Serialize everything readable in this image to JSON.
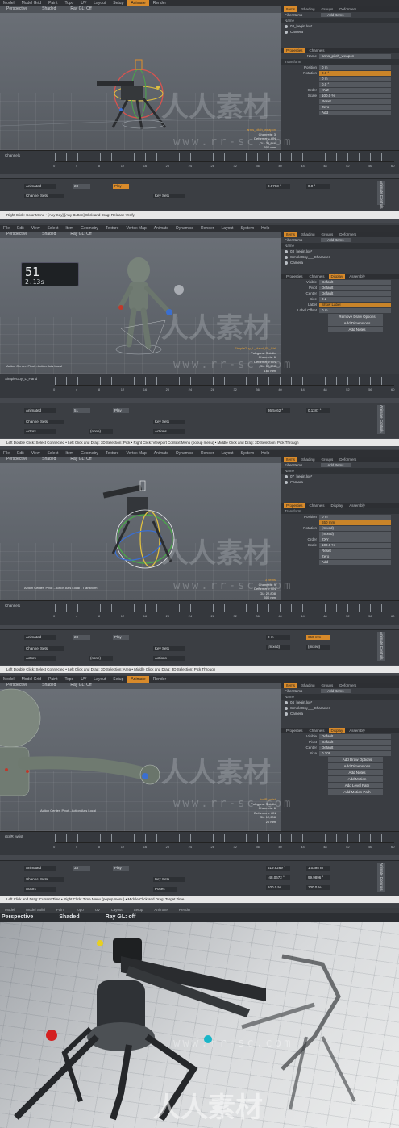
{
  "menus": {
    "tabs1": [
      "Model",
      "Model Grid",
      "Paint",
      "Topo",
      "UV",
      "Layout",
      "Setup",
      "Animate",
      "Render"
    ],
    "tabs2": [
      "File",
      "Edit",
      "View",
      "Select",
      "Item",
      "Geometry",
      "Texture",
      "Vertex Map",
      "Animate",
      "Dynamics",
      "Render",
      "Layout",
      "System",
      "Help"
    ]
  },
  "panels": [
    {
      "viewport": {
        "view": "Perspective",
        "shade": "Shaded",
        "ray": "Ray GL: Off"
      },
      "info": [
        "arms_pitch_weapon",
        "Channels: 3",
        "Deformers: ON",
        "GL: 23,846",
        "500 mm"
      ],
      "side_tabs": [
        "Items",
        "Shading",
        "Groups",
        "Deformers"
      ],
      "items": [
        "03_begin.lxo*",
        "Camera"
      ],
      "prop_tabs": [
        "Properties",
        "Channels"
      ],
      "name": "arms_pitch_weapon",
      "section": "Transform",
      "fields": [
        {
          "label": "Position",
          "value": "0 m"
        },
        {
          "label": "Rotation",
          "value": "0.0 °"
        },
        {
          "label": "",
          "value": "0 m"
        },
        {
          "label": "",
          "value": "0.0 °"
        },
        {
          "label": "Order",
          "value": "XYZ"
        },
        {
          "label": "Scale",
          "value": "100.0 %"
        }
      ],
      "reset_items": [
        "Reset",
        "Zero",
        "Add"
      ],
      "timeline_label": "Channels",
      "frame": "23",
      "values": [
        "0.0763 °",
        "0.0 °"
      ]
    },
    {
      "viewport": {
        "view": "Perspective",
        "shade": "Shaded",
        "ray": "Ray GL: Off"
      },
      "info": [
        "SimpleGuy_L_Hand_Fk_Ctrl",
        "Polygons: Subdiv",
        "Channels: 6",
        "Deformers: ON",
        "GL: 12,208",
        "160 mm"
      ],
      "timebox": {
        "frame": "51",
        "time": "2.13s"
      },
      "side_tabs": [
        "Items",
        "Shading",
        "Groups",
        "Deformers"
      ],
      "items": [
        "03_begin.lxo*",
        "SimpleGuy___Character",
        "Camera"
      ],
      "prop_tabs": [
        "Properties",
        "Channels",
        "Display",
        "Assembly"
      ],
      "fields": [
        {
          "label": "Visible",
          "value": "Default"
        },
        {
          "label": "Pivot",
          "value": "Default"
        },
        {
          "label": "Center",
          "value": "Default"
        },
        {
          "label": "Size",
          "value": "0.2"
        },
        {
          "label": "Label",
          "value": "Show Label"
        },
        {
          "label": "Label Offset",
          "value": "0 m"
        }
      ],
      "buttons": [
        "Remove Draw Options",
        "Add Dimensions",
        "Add Notes"
      ],
      "action_center": "Action Center: Pivot - Action Axis Local",
      "timeline_label": "SimpleGuy_L_Hand",
      "frame": "51",
      "values": [
        "36.5462 °",
        "0.1187 °"
      ],
      "status": "Left Double Click: Select Connected  •  Left Click and Drag: 3D Selection: Pick  •  Right Click: Viewport Context Menu (popup menu)  •  Middle Click and Drag: 3D Selection: Pick Through"
    },
    {
      "viewport": {
        "view": "Perspective",
        "shade": "Shaded",
        "ray": "Ray GL: Off"
      },
      "info": [
        "3 Items",
        "Channels: 9",
        "Deformers: ON",
        "GL: 22,808",
        "500 mm"
      ],
      "side_tabs": [
        "Items",
        "Shading",
        "Groups",
        "Deformers"
      ],
      "items": [
        "07_begin.lxo*",
        "Camera"
      ],
      "prop_tabs": [
        "Properties",
        "Channels",
        "Display",
        "Assembly"
      ],
      "section": "Transform",
      "fields": [
        {
          "label": "Position",
          "value": "0 m"
        },
        {
          "label": "",
          "value": "650 mm"
        },
        {
          "label": "Rotation",
          "value": "(mixed)"
        },
        {
          "label": "",
          "value": "(mixed)"
        },
        {
          "label": "Order",
          "value": "ZXY"
        },
        {
          "label": "Scale",
          "value": "100.0 %"
        }
      ],
      "reset_items": [
        "Reset",
        "Zero",
        "Add"
      ],
      "action_center": "Action Center: Pivot - Action Axis Local - Transform",
      "timeline_label": "Channels",
      "frame": "23",
      "values": [
        "0 m",
        "650 mm",
        "(mixed)",
        "(mixed)"
      ],
      "status": "Left Double Click: Select Connected  •  Left Click and Drag: 3D Selection: Area  •  Middle Click and Drag: 3D Selection: Pick Through"
    },
    {
      "viewport": {
        "view": "Perspective",
        "shade": "Shaded",
        "ray": "Ray GL: Off"
      },
      "info": [
        "rtcrlR_wrist",
        "Polygons: Subdiv",
        "Channels: 6",
        "Deformers: ON",
        "GL: 12,208",
        "20 mm"
      ],
      "side_tabs": [
        "Items",
        "Shading",
        "Groups",
        "Deformers"
      ],
      "items": [
        "04_begin.lxo*",
        "SimpleGuy___Character",
        "Camera"
      ],
      "prop_tabs": [
        "Properties",
        "Channels",
        "Display",
        "Assembly"
      ],
      "fields": [
        {
          "label": "Visible",
          "value": "Default"
        },
        {
          "label": "Pivot",
          "value": "Default"
        },
        {
          "label": "Center",
          "value": "Default"
        },
        {
          "label": "Size",
          "value": "0.108"
        }
      ],
      "buttons": [
        "Add Draw Options",
        "Add Dimensions",
        "Add Notes",
        "Add Motion",
        "Add Level Path",
        "Add Motion Path"
      ],
      "action_center": "Action Center: Pivot - Action Axis Local",
      "timeline_label": "rtcrlR_wrist",
      "frame": "33",
      "values": [
        "519.8269 °",
        "1.0395 m",
        "-48.0672 °",
        "99.9896 °",
        "100.0 %",
        "100.0 %"
      ],
      "status": "Left Click and Drag: Current Time  •  Right Click: Time Menu (popup menu)  •  Middle Click and Drag: Target Time"
    }
  ],
  "common": {
    "mode": "Animated",
    "play": "Play",
    "channel_sets": "Channel Sets",
    "actors": "Actors",
    "none": "(none)",
    "key_sets": "Key Sets",
    "actions": "Actions",
    "poses": "Poses",
    "add_items": "Add Items",
    "filter_items": "Filter Items",
    "name_col": "Name",
    "name_lbl": "Name",
    "auto_key": "Animate Controls",
    "status1": "Right Click: Color Menu  •  [Any Key]-[Any Button] Click and Drag: Release Verify"
  },
  "render": {
    "tabs": [
      "Model",
      "Model Solid",
      "Paint",
      "Topo",
      "UV",
      "Layout",
      "Setup",
      "Animate",
      "Render"
    ],
    "view": "Perspective",
    "shade": "Shaded",
    "ray": "Ray GL: off"
  },
  "watermark": {
    "cn": "人人素材",
    "url": "www.rr-sc.com"
  },
  "timeline_ticks": [
    "0",
    "2",
    "4",
    "6",
    "8",
    "10",
    "12",
    "14",
    "16",
    "18",
    "20",
    "22",
    "24",
    "26",
    "28",
    "30",
    "32",
    "34",
    "36",
    "38",
    "40",
    "42",
    "44",
    "46",
    "48",
    "50",
    "52",
    "54",
    "56",
    "58",
    "60"
  ],
  "colors": {
    "accent": "#d88a2a",
    "panel": "#45484e",
    "viewport": "#62676e"
  }
}
